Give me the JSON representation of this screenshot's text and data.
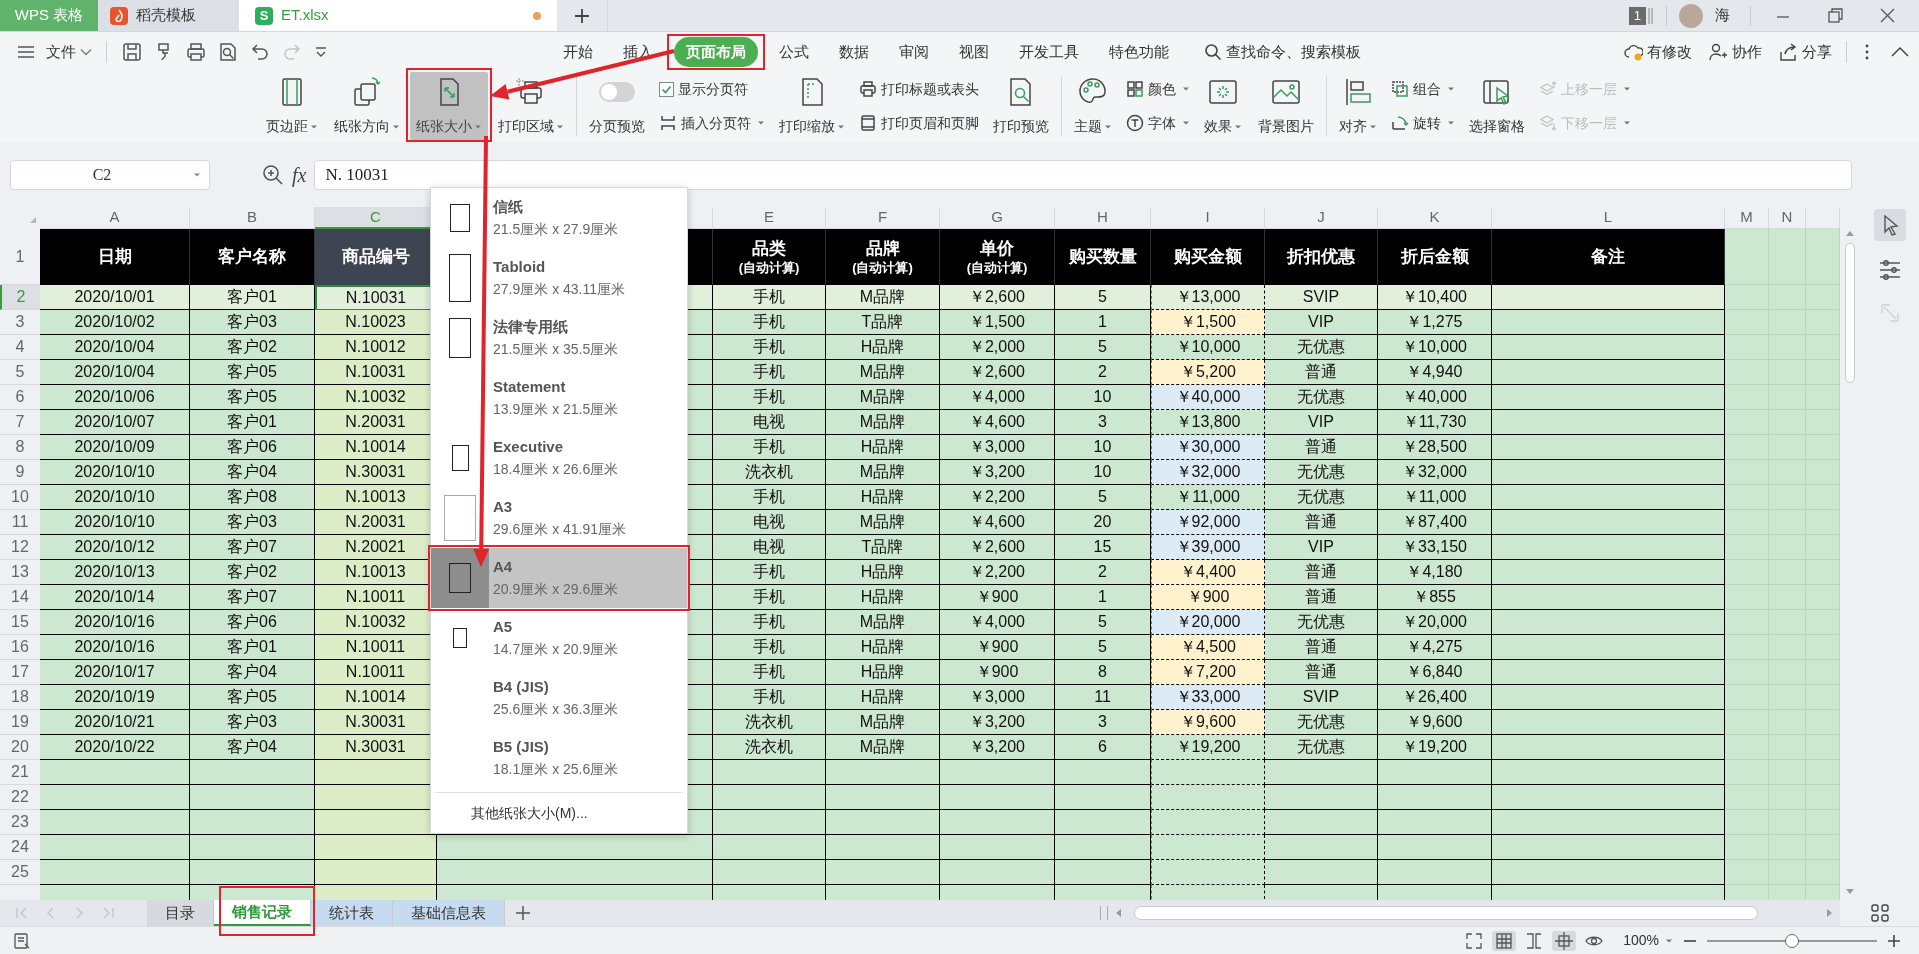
{
  "title_tabs": [
    {
      "kind": "app",
      "label": "WPS 表格",
      "selected": false
    },
    {
      "kind": "docer",
      "label": "稻壳模板",
      "selected": false
    },
    {
      "kind": "file",
      "label": "ET.xlsx",
      "icon_text": "S",
      "selected": true,
      "modified": true
    }
  ],
  "account": {
    "badge": "1",
    "user": "海"
  },
  "menu": {
    "file": "文件",
    "quick_access": [
      {
        "disabled": false
      },
      {
        "disabled": false
      },
      {
        "disabled": false
      },
      {
        "disabled": false
      },
      {
        "disabled": false
      },
      {
        "disabled": true
      }
    ],
    "tabs": [
      {
        "label": "开始",
        "selected": false
      },
      {
        "label": "插入",
        "selected": false
      },
      {
        "label": "页面布局",
        "selected": true
      },
      {
        "label": "公式",
        "selected": false
      },
      {
        "label": "数据",
        "selected": false
      },
      {
        "label": "审阅",
        "selected": false
      },
      {
        "label": "视图",
        "selected": false
      },
      {
        "label": "开发工具",
        "selected": false
      },
      {
        "label": "特色功能",
        "selected": false
      }
    ],
    "search": "查找命令、搜索模板",
    "actions": [
      "有修改",
      "协作",
      "分享"
    ]
  },
  "ribbon": {
    "groups": [
      {
        "items": [
          {
            "kind": "large",
            "label": "页边距",
            "dropdown": true,
            "selected": false
          },
          {
            "kind": "large",
            "label": "纸张方向",
            "dropdown": true,
            "selected": false
          },
          {
            "kind": "large",
            "label": "纸张大小",
            "dropdown": true,
            "selected": true
          },
          {
            "kind": "large",
            "label": "打印区域",
            "dropdown": true,
            "selected": false
          }
        ]
      },
      {
        "items": [
          {
            "kind": "toggle",
            "label": "分页预览",
            "on": false
          },
          {
            "kind": "stack",
            "items": [
              {
                "kind": "checkbox",
                "label": "显示分页符",
                "checked": true
              },
              {
                "kind": "small",
                "label": "插入分页符",
                "dropdown": true,
                "disabled": false
              }
            ]
          },
          {
            "kind": "large",
            "label": "打印缩放",
            "dropdown": true,
            "selected": false
          },
          {
            "kind": "stack",
            "items": [
              {
                "kind": "small",
                "label": "打印标题或表头",
                "dropdown": false,
                "disabled": false
              },
              {
                "kind": "small",
                "label": "打印页眉和页脚",
                "dropdown": false,
                "disabled": false
              }
            ]
          },
          {
            "kind": "large",
            "label": "打印预览",
            "dropdown": false,
            "selected": false
          }
        ]
      },
      {
        "items": [
          {
            "kind": "large",
            "label": "主题",
            "dropdown": true,
            "selected": false
          },
          {
            "kind": "stack",
            "items": [
              {
                "kind": "small",
                "label": "颜色",
                "dropdown": true,
                "disabled": false
              },
              {
                "kind": "small",
                "label": "字体",
                "dropdown": true,
                "disabled": false
              }
            ]
          },
          {
            "kind": "large",
            "label": "效果",
            "dropdown": true,
            "selected": false
          },
          {
            "kind": "large",
            "label": "背景图片",
            "dropdown": false,
            "selected": false
          }
        ]
      },
      {
        "items": [
          {
            "kind": "large",
            "label": "对齐",
            "dropdown": true,
            "selected": false
          },
          {
            "kind": "stack",
            "items": [
              {
                "kind": "small",
                "label": "组合",
                "dropdown": true,
                "disabled": false
              },
              {
                "kind": "small",
                "label": "旋转",
                "dropdown": true,
                "disabled": false
              }
            ]
          },
          {
            "kind": "large",
            "label": "选择窗格",
            "dropdown": false,
            "selected": false
          },
          {
            "kind": "stack",
            "items": [
              {
                "kind": "small",
                "label": "上移一层",
                "dropdown": true,
                "disabled": true
              },
              {
                "kind": "small",
                "label": "下移一层",
                "dropdown": true,
                "disabled": true
              }
            ]
          }
        ]
      }
    ]
  },
  "formula_bar": {
    "name_box": "C2",
    "fx": "fx",
    "value": "N. 10031"
  },
  "paper_size_menu": {
    "items": [
      {
        "title": "信纸",
        "size": "21.5厘米 x 27.9厘米",
        "icon": true,
        "selected": false
      },
      {
        "title": "Tabloid",
        "size": "27.9厘米 x 43.11厘米",
        "icon": true,
        "selected": false
      },
      {
        "title": "法律专用纸",
        "size": "21.5厘米 x 35.5厘米",
        "icon": true,
        "selected": false
      },
      {
        "title": "Statement",
        "size": "13.9厘米 x 21.5厘米",
        "icon": false,
        "selected": false
      },
      {
        "title": "Executive",
        "size": "18.4厘米 x 26.6厘米",
        "icon": true,
        "selected": false
      },
      {
        "title": "A3",
        "size": "29.6厘米 x 41.91厘米",
        "icon": true,
        "selected": false
      },
      {
        "title": "A4",
        "size": "20.9厘米 x 29.6厘米",
        "icon": true,
        "selected": true
      },
      {
        "title": "A5",
        "size": "14.7厘米 x 20.9厘米",
        "icon": true,
        "selected": false
      },
      {
        "title": "B4 (JIS)",
        "size": "25.6厘米 x 36.3厘米",
        "icon": false,
        "selected": false
      },
      {
        "title": "B5 (JIS)",
        "size": "18.1厘米 x 25.6厘米",
        "icon": false,
        "selected": false
      }
    ],
    "more": "其他纸张大小(M)..."
  },
  "sheet": {
    "columns": [
      {
        "letter": "A",
        "selected": false
      },
      {
        "letter": "B",
        "selected": false
      },
      {
        "letter": "C",
        "selected": true
      },
      {
        "selected": false
      },
      {
        "letter": "E",
        "selected": false
      },
      {
        "letter": "F",
        "selected": false
      },
      {
        "letter": "G",
        "selected": false
      },
      {
        "letter": "H",
        "selected": false
      },
      {
        "letter": "I",
        "selected": false
      },
      {
        "letter": "J",
        "selected": false
      },
      {
        "letter": "K",
        "selected": false
      },
      {
        "letter": "L",
        "selected": false
      },
      {
        "letter": "M",
        "selected": false
      },
      {
        "letter": "N",
        "selected": false
      }
    ],
    "header_number": "1",
    "header": [
      {
        "title": "日期"
      },
      {
        "title": "客户名称"
      },
      {
        "title": "商品编号"
      },
      {
        "title": "品类",
        "subtitle": "(自动计算)"
      },
      {
        "title": "品牌",
        "subtitle": "(自动计算)"
      },
      {
        "title": "单价",
        "subtitle": "(自动计算)"
      },
      {
        "title": "购买数量"
      },
      {
        "title": "购买金额"
      },
      {
        "title": "折扣优惠"
      },
      {
        "title": "折后金额"
      },
      {
        "title": "备注"
      }
    ],
    "rows": [
      {
        "number": "2",
        "selected": true,
        "date": "2020/10/01",
        "customer": "客户01",
        "code": "N.10031",
        "category": "手机",
        "brand": "M品牌",
        "price": "￥2,600",
        "qty": "5",
        "amount": {
          "text": "￥13,000"
        },
        "discount": "SVIP",
        "net": "￥10,400"
      },
      {
        "number": "3",
        "selected": false,
        "date": "2020/10/02",
        "customer": "客户03",
        "code": "N.10023",
        "category": "手机",
        "brand": "T品牌",
        "price": "￥1,500",
        "qty": "1",
        "amount": {
          "text": "￥1,500",
          "color": "#fff2cc"
        },
        "discount": "VIP",
        "net": "￥1,275"
      },
      {
        "number": "4",
        "selected": false,
        "date": "2020/10/04",
        "customer": "客户02",
        "code": "N.10012",
        "category": "手机",
        "brand": "H品牌",
        "price": "￥2,000",
        "qty": "5",
        "amount": {
          "text": "￥10,000"
        },
        "discount": "无优惠",
        "net": "￥10,000"
      },
      {
        "number": "5",
        "selected": false,
        "date": "2020/10/04",
        "customer": "客户05",
        "code": "N.10031",
        "category": "手机",
        "brand": "M品牌",
        "price": "￥2,600",
        "qty": "2",
        "amount": {
          "text": "￥5,200",
          "color": "#fff2cc"
        },
        "discount": "普通",
        "net": "￥4,940"
      },
      {
        "number": "6",
        "selected": false,
        "date": "2020/10/06",
        "customer": "客户05",
        "code": "N.10032",
        "category": "手机",
        "brand": "M品牌",
        "price": "￥4,000",
        "qty": "10",
        "amount": {
          "text": "￥40,000",
          "color": "#ddebf7"
        },
        "discount": "无优惠",
        "net": "￥40,000"
      },
      {
        "number": "7",
        "selected": false,
        "date": "2020/10/07",
        "customer": "客户01",
        "code": "N.20031",
        "category": "电视",
        "brand": "M品牌",
        "price": "￥4,600",
        "qty": "3",
        "amount": {
          "text": "￥13,800"
        },
        "discount": "VIP",
        "net": "￥11,730"
      },
      {
        "number": "8",
        "selected": false,
        "date": "2020/10/09",
        "customer": "客户06",
        "code": "N.10014",
        "category": "手机",
        "brand": "H品牌",
        "price": "￥3,000",
        "qty": "10",
        "amount": {
          "text": "￥30,000",
          "color": "#ddebf7"
        },
        "discount": "普通",
        "net": "￥28,500"
      },
      {
        "number": "9",
        "selected": false,
        "date": "2020/10/10",
        "customer": "客户04",
        "code": "N.30031",
        "category": "洗衣机",
        "brand": "M品牌",
        "price": "￥3,200",
        "qty": "10",
        "amount": {
          "text": "￥32,000",
          "color": "#ddebf7"
        },
        "discount": "无优惠",
        "net": "￥32,000"
      },
      {
        "number": "10",
        "selected": false,
        "date": "2020/10/10",
        "customer": "客户08",
        "code": "N.10013",
        "category": "手机",
        "brand": "H品牌",
        "price": "￥2,200",
        "qty": "5",
        "amount": {
          "text": "￥11,000"
        },
        "discount": "无优惠",
        "net": "￥11,000"
      },
      {
        "number": "11",
        "selected": false,
        "date": "2020/10/10",
        "customer": "客户03",
        "code": "N.20031",
        "category": "电视",
        "brand": "M品牌",
        "price": "￥4,600",
        "qty": "20",
        "amount": {
          "text": "￥92,000",
          "color": "#ddebf7"
        },
        "discount": "普通",
        "net": "￥87,400"
      },
      {
        "number": "12",
        "selected": false,
        "date": "2020/10/12",
        "customer": "客户07",
        "code": "N.20021",
        "category": "电视",
        "brand": "T品牌",
        "price": "￥2,600",
        "qty": "15",
        "amount": {
          "text": "￥39,000",
          "color": "#ddebf7"
        },
        "discount": "VIP",
        "net": "￥33,150"
      },
      {
        "number": "13",
        "selected": false,
        "date": "2020/10/13",
        "customer": "客户02",
        "code": "N.10013",
        "category": "手机",
        "brand": "H品牌",
        "price": "￥2,200",
        "qty": "2",
        "amount": {
          "text": "￥4,400",
          "color": "#fff2cc"
        },
        "discount": "普通",
        "net": "￥4,180"
      },
      {
        "number": "14",
        "selected": false,
        "date": "2020/10/14",
        "customer": "客户07",
        "code": "N.10011",
        "category": "手机",
        "brand": "H品牌",
        "price": "￥900",
        "qty": "1",
        "amount": {
          "text": "￥900",
          "color": "#fff2cc"
        },
        "discount": "普通",
        "net": "￥855"
      },
      {
        "number": "15",
        "selected": false,
        "date": "2020/10/16",
        "customer": "客户06",
        "code": "N.10032",
        "category": "手机",
        "brand": "M品牌",
        "price": "￥4,000",
        "qty": "5",
        "amount": {
          "text": "￥20,000",
          "color": "#ddebf7"
        },
        "discount": "无优惠",
        "net": "￥20,000"
      },
      {
        "number": "16",
        "selected": false,
        "date": "2020/10/16",
        "customer": "客户01",
        "code": "N.10011",
        "category": "手机",
        "brand": "H品牌",
        "price": "￥900",
        "qty": "5",
        "amount": {
          "text": "￥4,500",
          "color": "#fff2cc"
        },
        "discount": "普通",
        "net": "￥4,275"
      },
      {
        "number": "17",
        "selected": false,
        "date": "2020/10/17",
        "customer": "客户04",
        "code": "N.10011",
        "category": "手机",
        "brand": "H品牌",
        "price": "￥900",
        "qty": "8",
        "amount": {
          "text": "￥7,200",
          "color": "#fff2cc"
        },
        "discount": "普通",
        "net": "￥6,840"
      },
      {
        "number": "18",
        "selected": false,
        "date": "2020/10/19",
        "customer": "客户05",
        "code": "N.10014",
        "category": "手机",
        "brand": "H品牌",
        "price": "￥3,000",
        "qty": "11",
        "amount": {
          "text": "￥33,000",
          "color": "#ddebf7"
        },
        "discount": "SVIP",
        "net": "￥26,400"
      },
      {
        "number": "19",
        "selected": false,
        "date": "2020/10/21",
        "customer": "客户03",
        "code": "N.30031",
        "category": "洗衣机",
        "brand": "M品牌",
        "price": "￥3,200",
        "qty": "3",
        "amount": {
          "text": "￥9,600",
          "color": "#fff2cc"
        },
        "discount": "无优惠",
        "net": "￥9,600"
      },
      {
        "number": "20",
        "selected": false,
        "date": "2020/10/22",
        "customer": "客户04",
        "code": "N.30031",
        "category": "洗衣机",
        "brand": "M品牌",
        "price": "￥3,200",
        "qty": "6",
        "amount": {
          "text": "￥19,200"
        },
        "discount": "无优惠",
        "net": "￥19,200"
      }
    ],
    "empty_rows": [
      "21",
      "22",
      "23",
      "24",
      "25"
    ]
  },
  "side_tools": [
    {
      "selected": true,
      "disabled": false
    },
    {
      "selected": false,
      "disabled": false
    },
    {
      "selected": false,
      "disabled": true
    }
  ],
  "sheet_tabs": [
    {
      "label": "目录",
      "selected": false
    },
    {
      "label": "销售记录",
      "selected": true
    },
    {
      "label": "统计表",
      "selected": false,
      "color": "#c6dbef"
    },
    {
      "label": "基础信息表",
      "selected": false,
      "color": "#c6dbef"
    }
  ],
  "status_bar": {
    "views": [
      {
        "selected": false
      },
      {
        "selected": true
      },
      {
        "selected": false
      },
      {
        "selected": true
      },
      {
        "selected": false
      }
    ],
    "zoom": "100%",
    "zoom_slider": {
      "level": 0.5
    }
  }
}
